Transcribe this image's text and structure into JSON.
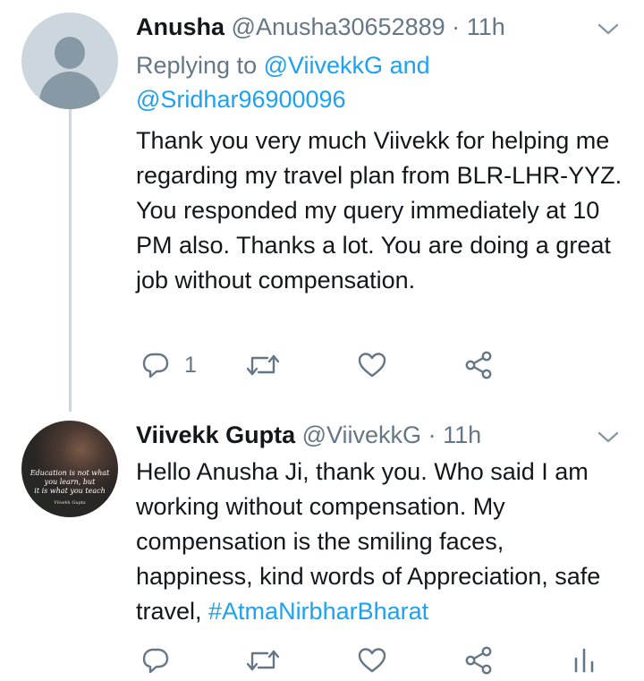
{
  "tweets": [
    {
      "display_name": "Anusha",
      "handle": "@Anusha30652889",
      "separator": "·",
      "time": "11h",
      "replying_prefix": "Replying to",
      "replying_user_1": "@ViivekkG",
      "replying_and": "and",
      "replying_user_2": "@Sridhar96900096",
      "text": "Thank you very much Viivekk for helping me regarding my travel plan from BLR-LHR-YYZ. You responded my query immediately at 10 PM also. Thanks a lot. You are doing a great job without compensation.",
      "reply_count": "1",
      "avatar_icon": "default-profile-icon"
    },
    {
      "display_name": "Viivekk Gupta",
      "handle": "@ViivekkG",
      "separator": "·",
      "time": "11h",
      "text": "Hello Anusha Ji, thank you. Who said I am working without compensation. My compensation is the smiling faces, happiness, kind words of Appreciation, safe travel, ",
      "hashtag": "#AtmaNirbharBharat",
      "avatar_caption_1": "Education is not what",
      "avatar_caption_2": "you learn, but",
      "avatar_caption_3": "it is what you teach",
      "avatar_signature": "Viivekk Gupta"
    }
  ],
  "icons": {
    "reply": "reply-icon",
    "retweet": "retweet-icon",
    "like": "heart-icon",
    "share": "share-icon",
    "analytics": "analytics-icon",
    "menu": "chevron-down-icon"
  },
  "colors": {
    "text": "#14171a",
    "secondary": "#657786",
    "link": "#1da1f2",
    "thread_line": "#ccd6dd",
    "avatar_bg": "#ccd6dd",
    "avatar_fg": "#8899a6"
  }
}
